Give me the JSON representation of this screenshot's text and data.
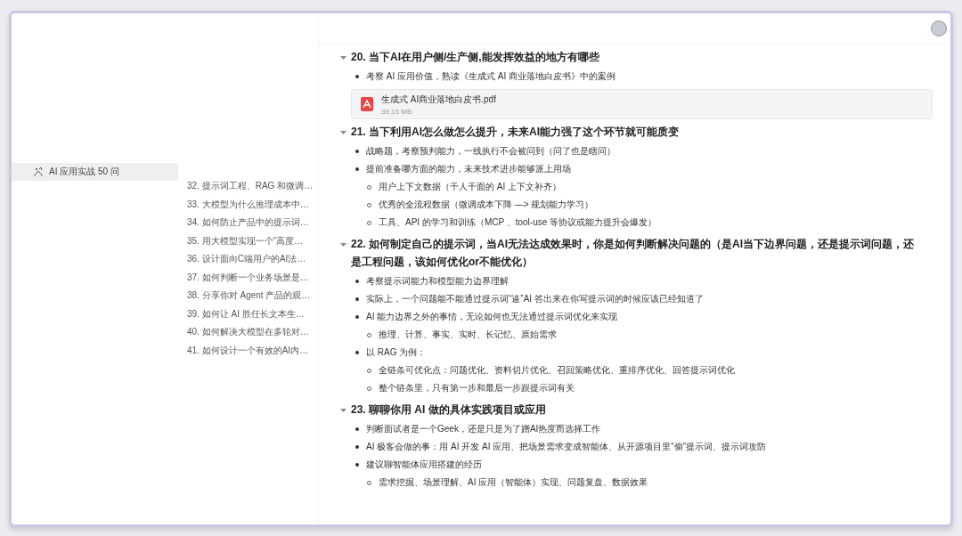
{
  "sidebar": {
    "items": [
      {
        "label": "AI 应用实战 50 问",
        "selected": true
      }
    ]
  },
  "toc": {
    "items": [
      "32. 提示词工程、RAG 和微调…",
      "33. 大模型为什么推理成本中…",
      "34. 如何防止产品中的提示词…",
      "35. 用大模型实现一个“高度…",
      "36. 设计面向C端用户的AI法…",
      "37. 如何判断一个业务场景是…",
      "38. 分享你对 Agent 产品的观…",
      "39. 如何让 AI 胜任长文本生…",
      "40. 如何解决大模型在多轮对…",
      "41. 如何设计一个有效的AI内…"
    ]
  },
  "sections": [
    {
      "title": "20. 当下AI在用户侧/生产侧,能发挥效益的地方有哪些",
      "expanded": true,
      "items": [
        {
          "text": "考察 AI 应用价值，熟读《生成式 AI 商业落地白皮书》中的案例"
        }
      ],
      "attachment": {
        "name": "生成式 AI商业落地白皮书.pdf",
        "size": "39.15 MB"
      }
    },
    {
      "title": "21. 当下利用AI怎么做怎么提升，未来AI能力强了这个环节就可能质变",
      "expanded": true,
      "items": [
        {
          "text": "战略题，考察预判能力，一线执行不会被问到（问了也是瞎问）"
        },
        {
          "text": "提前准备哪方面的能力，未来技术进步能够派上用场",
          "children": [
            "用户上下文数据（千人千面的 AI 上下文补齐）",
            "优秀的全流程数据（微调成本下降 —> 规划能力学习）",
            "工具、API 的学习和训练（MCP 、tool-use 等协议或能力提升会爆发）"
          ]
        }
      ]
    },
    {
      "title": "22. 如何制定自己的提示词，当AI无法达成效果时，你是如何判断解决问题的（是AI当下边界问题，还是提示词问题，还是工程问题，该如何优化or不能优化）",
      "expanded": true,
      "items": [
        {
          "text": "考察提示词能力和模型能力边界理解"
        },
        {
          "text": "实际上，一个问题能不能通过提示词“逼”AI 答出来在你写提示词的时候应该已经知道了"
        },
        {
          "text": "AI 能力边界之外的事情，无论如何也无法通过提示词优化来实现",
          "children": [
            "推理、计算、事实、实时、长记忆、原始需求"
          ]
        },
        {
          "text": "以 RAG 为例：",
          "children": [
            "全链条可优化点：问题优化、资料切片优化、召回策略优化、重排序优化、回答提示词优化",
            "整个链条里，只有第一步和最后一步跟提示词有关"
          ]
        }
      ]
    },
    {
      "title": "23. 聊聊你用 AI 做的具体实践项目或应用",
      "expanded": true,
      "items": [
        {
          "text": "判断面试者是一个Geek，还是只是为了蹭AI热度而选择工作"
        },
        {
          "text": "AI 极客会做的事：用 AI 开发 AI 应用、把场景需求变成智能体、从开源项目里“偷”提示词、提示词攻防"
        },
        {
          "text": "建议聊智能体应用搭建的经历",
          "children": [
            "需求挖掘、场景理解、AI 应用（智能体）实现、问题复盘、数据效果"
          ]
        }
      ]
    }
  ]
}
